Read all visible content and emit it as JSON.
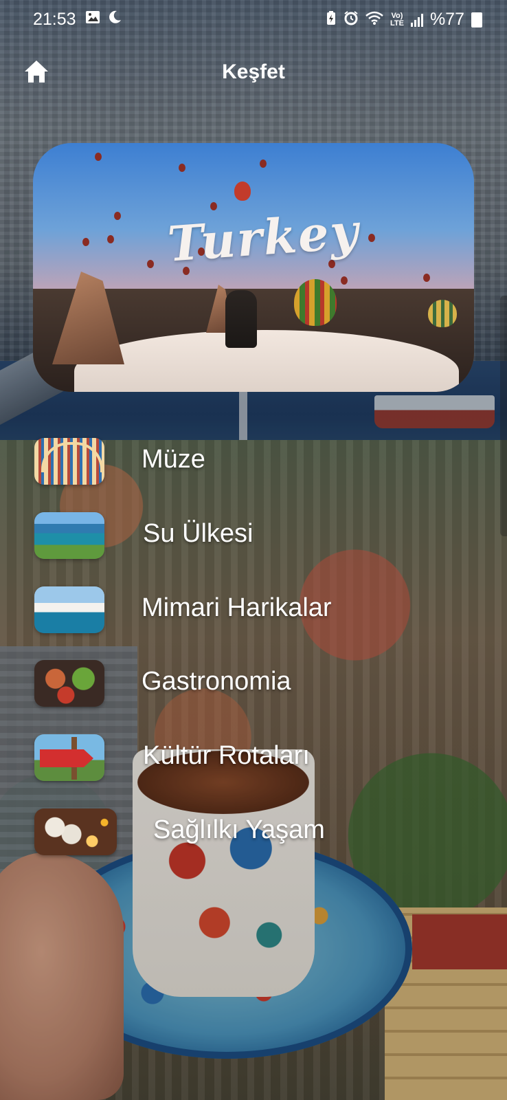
{
  "status_bar": {
    "time": "21:53",
    "battery": "%77"
  },
  "header": {
    "title": "Keşfet",
    "home_icon": "home-icon"
  },
  "hero": {
    "title": "Turkey"
  },
  "menu": {
    "items": [
      {
        "label": "Müze",
        "thumb": "museum-thumbnail"
      },
      {
        "label": "Su Ülkesi",
        "thumb": "coast-thumbnail"
      },
      {
        "label": "Mimari Harikalar",
        "thumb": "architecture-thumbnail"
      },
      {
        "label": "Gastronomia",
        "thumb": "food-thumbnail"
      },
      {
        "label": "Kültür Rotaları",
        "thumb": "culture-route-thumbnail"
      },
      {
        "label": "Sağlılkı Yaşam",
        "thumb": "spa-thumbnail"
      }
    ]
  },
  "colors": {
    "text": "#ffffff",
    "flag_red": "#d32f2f"
  }
}
